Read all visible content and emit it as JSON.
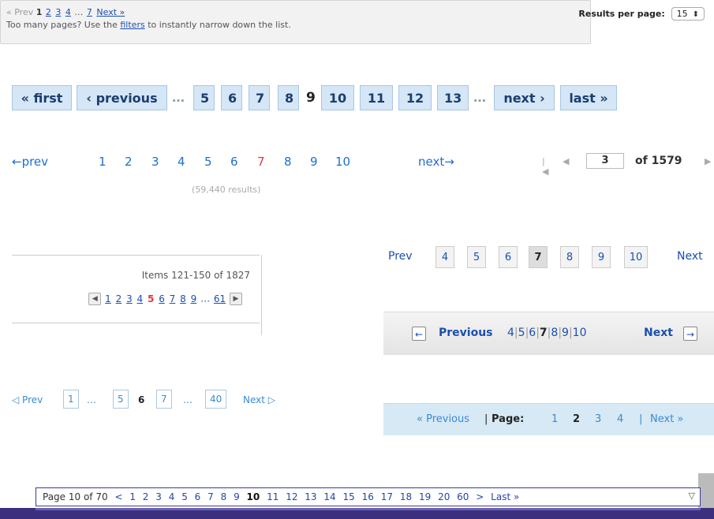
{
  "p1": {
    "prev": "« Prev",
    "current": "1",
    "pages": [
      "2",
      "3",
      "4"
    ],
    "ellipsis": "…",
    "last": "7",
    "next": "Next »",
    "hint_before": "Too many pages? Use the ",
    "hint_link": "filters",
    "hint_after": " to instantly narrow down the list.",
    "rpp_label": "Results per page:",
    "rpp_value": "15",
    "rpp_arrow": "⬍"
  },
  "p2": {
    "first": "« first",
    "previous": "‹ previous",
    "ellipsis": "…",
    "pages_before": [
      "5",
      "6",
      "7",
      "8"
    ],
    "current": "9",
    "pages_after": [
      "10",
      "11",
      "12",
      "13"
    ],
    "next": "next ›",
    "last": "last »"
  },
  "p3": {
    "prev": "←prev",
    "pages": [
      "1",
      "2",
      "3",
      "4",
      "5",
      "6",
      "7",
      "8",
      "9",
      "10"
    ],
    "current": "7",
    "next": "next→",
    "results": "(59,440 results)"
  },
  "p4": {
    "first_icon": "first-page-icon",
    "prev_icon": "prev-page-icon",
    "value": "3",
    "of": "of 1579"
  },
  "p5": {
    "items": "Items 121-150 of 1827",
    "pages_before": [
      "1",
      "2",
      "3",
      "4"
    ],
    "current": "5",
    "pages_after": [
      "6",
      "7",
      "8",
      "9"
    ],
    "ellipsis": "…",
    "last": "61",
    "left_arrow": "◀",
    "right_arrow": "▶"
  },
  "p6": {
    "prev": "Prev",
    "pages": [
      "4",
      "5",
      "6",
      "7",
      "8",
      "9",
      "10"
    ],
    "current": "7",
    "next": "Next"
  },
  "p7": {
    "left_arrow": "←",
    "previous": "Previous",
    "pages_text": [
      "4",
      "5",
      "6",
      "7",
      "8",
      "9",
      "10"
    ],
    "current": "7",
    "next": "Next",
    "right_arrow": "→"
  },
  "p8": {
    "prev": "◁ Prev",
    "first": "1",
    "ellipsis": "…",
    "p5": "5",
    "current": "6",
    "p7": "7",
    "last": "40",
    "next": "Next ▷"
  },
  "p9": {
    "previous": "« Previous",
    "sep": "|",
    "page_label": "Page:",
    "pages": [
      "1",
      "2",
      "3",
      "4"
    ],
    "current": "2",
    "next": "Next »"
  },
  "p10": {
    "label": "Page 10 of 70",
    "lt": "<",
    "pages_before": [
      "1",
      "2",
      "3",
      "4",
      "5",
      "6",
      "7",
      "8",
      "9"
    ],
    "current": "10",
    "pages_after": [
      "11",
      "12",
      "13",
      "14",
      "15",
      "16",
      "17",
      "18",
      "19",
      "20",
      "60"
    ],
    "gt": ">",
    "last": "Last »",
    "dropdown": "▽"
  }
}
